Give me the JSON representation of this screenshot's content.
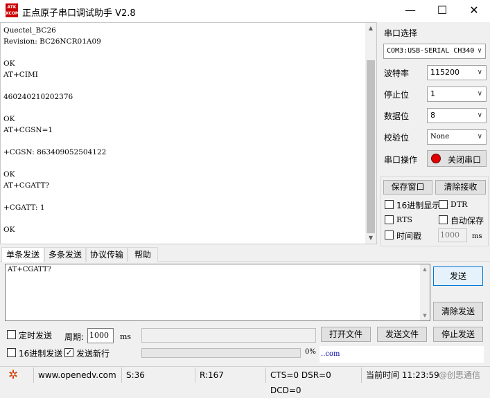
{
  "window": {
    "logo_text": "ATK\nXCOM",
    "title": "正点原子串口调试助手 V2.8",
    "minimize_glyph": "—",
    "maximize_glyph": "☐",
    "close_glyph": "✕"
  },
  "receive": {
    "lines": [
      "Quectel_BC26",
      "Revision: BC26NCR01A09",
      "",
      "OK",
      "AT+CIMI",
      "",
      "460240210202376",
      "",
      "OK",
      "AT+CGSN=1",
      "",
      "+CGSN: 863409052504122",
      "",
      "OK",
      "AT+CGATT?",
      "",
      "+CGATT: 1",
      "",
      "OK"
    ]
  },
  "serial": {
    "port_label": "串口选择",
    "port_value": "COM3:USB-SERIAL CH340",
    "baud_label": "波特率",
    "baud_value": "115200",
    "stopbits_label": "停止位",
    "stopbits_value": "1",
    "databits_label": "数据位",
    "databits_value": "8",
    "parity_label": "校验位",
    "parity_value": "None",
    "operation_label": "串口操作",
    "close_port_button": "关闭串口",
    "status_color": "#e00000"
  },
  "receive_options": {
    "save_window_button": "保存窗口",
    "clear_receive_button": "清除接收",
    "hex_display_label": "16进制显示",
    "hex_display_checked": false,
    "dtr_label": "DTR",
    "dtr_checked": false,
    "rts_label": "RTS",
    "rts_checked": false,
    "auto_save_label": "自动保存",
    "auto_save_checked": false,
    "timestamp_label": "时间戳",
    "timestamp_checked": false,
    "timestamp_ms_value": "1000",
    "timestamp_unit": "ms"
  },
  "tabs": [
    "单条发送",
    "多条发送",
    "协议传输",
    "帮助"
  ],
  "send": {
    "text": "AT+CGATT?",
    "send_button": "发送",
    "clear_send_button": "清除发送",
    "timed_send_label": "定时发送",
    "timed_send_checked": false,
    "period_label": "周期:",
    "period_value": "1000",
    "period_unit": "ms",
    "open_file_button": "打开文件",
    "send_file_button": "发送文件",
    "stop_send_button": "停止发送",
    "hex_send_label": "16进制发送",
    "hex_send_checked": false,
    "send_newline_label": "发送新行",
    "send_newline_checked": true,
    "progress_percent": "0%",
    "progress": 0,
    "link_text": "..com"
  },
  "statusbar": {
    "gear_icon_color": "#d04000",
    "website": "www.openedv.com",
    "sent": "S:36",
    "received": "R:167",
    "lines_status": "CTS=0 DSR=0 DCD=0",
    "time_label": "当前时间 11:23:59",
    "watermark": "@创思通信"
  }
}
